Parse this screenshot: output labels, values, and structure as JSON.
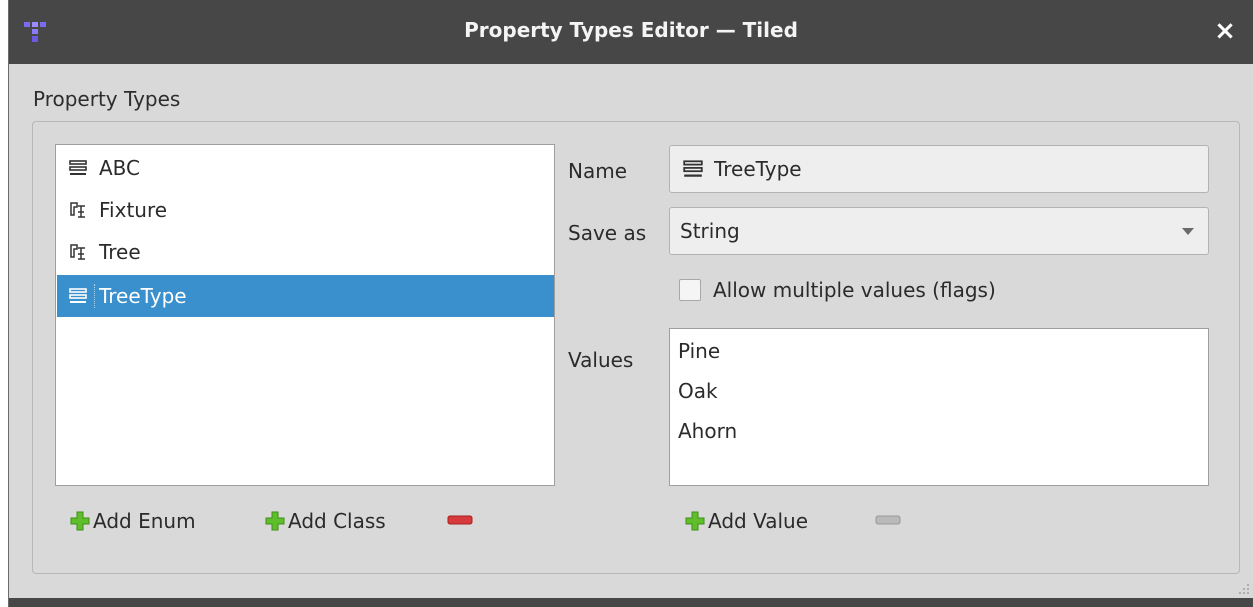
{
  "window": {
    "title": "Property Types Editor — Tiled",
    "close_label": "×"
  },
  "group": {
    "label": "Property Types"
  },
  "types": [
    {
      "label": "ABC",
      "kind": "enum",
      "icon": "enum-icon"
    },
    {
      "label": "Fixture",
      "kind": "class",
      "icon": "class-icon"
    },
    {
      "label": "Tree",
      "kind": "class",
      "icon": "class-icon"
    },
    {
      "label": "TreeType",
      "kind": "enum",
      "icon": "enum-icon",
      "selected": true
    }
  ],
  "type_buttons": {
    "add_enum": "Add Enum",
    "add_class": "Add Class",
    "remove_icon": "remove-icon"
  },
  "editor": {
    "name_label": "Name",
    "name_value": "TreeType",
    "save_as_label": "Save as",
    "save_as_value": "String",
    "flags_label": "Allow multiple values (flags)",
    "flags_checked": false,
    "values_label": "Values",
    "values": [
      "Pine",
      "Oak",
      "Ahorn"
    ],
    "add_value": "Add Value",
    "remove_value_icon": "remove-icon"
  },
  "colors": {
    "titlebar": "#474747",
    "selection": "#3a8fcd",
    "add_green": "#5fbf2a",
    "remove_red": "#d63a3a"
  }
}
